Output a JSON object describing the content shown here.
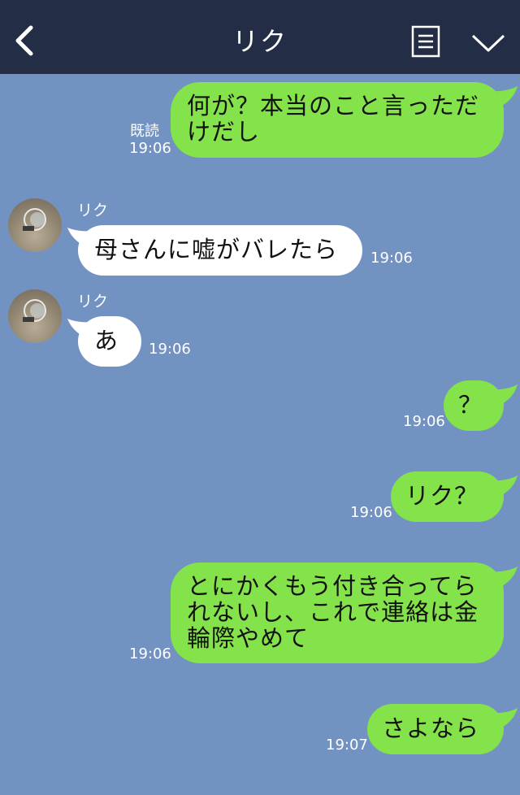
{
  "header": {
    "title": "リク",
    "back_icon": "chevron-left-icon",
    "menu_icon": "menu-icon",
    "expand_icon": "chevron-down-icon",
    "background": "#232d45"
  },
  "chat_background": "#7292c2",
  "colors": {
    "outgoing": "#84e24a",
    "incoming": "#ffffff"
  },
  "messages": [
    {
      "direction": "out",
      "lines": [
        "何が？本当のこと言っただ",
        "けだし"
      ],
      "read": "既読",
      "time": "19:06"
    },
    {
      "direction": "in",
      "sender": "リク",
      "lines": [
        "母さんに嘘がバレたら"
      ],
      "time": "19:06"
    },
    {
      "direction": "in",
      "sender": "リク",
      "lines": [
        "あ"
      ],
      "time": "19:06"
    },
    {
      "direction": "out",
      "lines": [
        "？"
      ],
      "time": "19:06"
    },
    {
      "direction": "out",
      "lines": [
        "リク？"
      ],
      "time": "19:06"
    },
    {
      "direction": "out",
      "lines": [
        "とにかくもう付き合ってら",
        "れないし、これで連絡は金",
        "輪際やめて"
      ],
      "time": "19:06"
    },
    {
      "direction": "out",
      "lines": [
        "さよなら"
      ],
      "time": "19:07"
    }
  ]
}
